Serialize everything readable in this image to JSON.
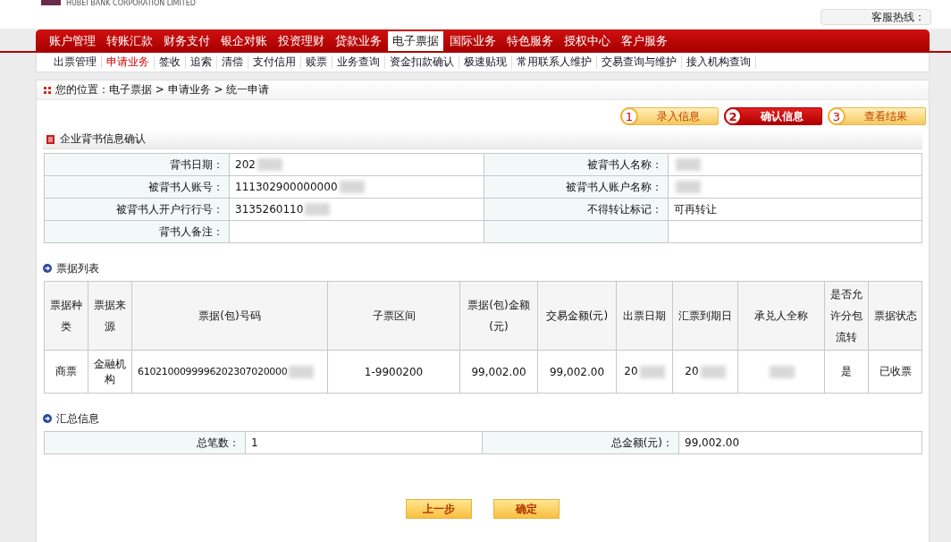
{
  "header": {
    "bank_subtitle": "HUBEI BANK CORPORATION LIMITED",
    "hotline_label": "客服热线："
  },
  "main_nav": [
    {
      "label": "账户管理",
      "selected": false
    },
    {
      "label": "转账汇款",
      "selected": false
    },
    {
      "label": "财务支付",
      "selected": false
    },
    {
      "label": "银企对账",
      "selected": false
    },
    {
      "label": "投资理财",
      "selected": false
    },
    {
      "label": "贷款业务",
      "selected": false
    },
    {
      "label": "电子票据",
      "selected": true
    },
    {
      "label": "国际业务",
      "selected": false
    },
    {
      "label": "特色服务",
      "selected": false
    },
    {
      "label": "授权中心",
      "selected": false
    },
    {
      "label": "客户服务",
      "selected": false
    }
  ],
  "sub_nav": [
    {
      "label": "出票管理",
      "selected": false
    },
    {
      "label": "申请业务",
      "selected": true
    },
    {
      "label": "签收",
      "selected": false
    },
    {
      "label": "追索",
      "selected": false
    },
    {
      "label": "清偿",
      "selected": false
    },
    {
      "label": "支付信用",
      "selected": false
    },
    {
      "label": "赎票",
      "selected": false
    },
    {
      "label": "业务查询",
      "selected": false
    },
    {
      "label": "资金扣款确认",
      "selected": false
    },
    {
      "label": "极速贴现",
      "selected": false
    },
    {
      "label": "常用联系人维护",
      "selected": false
    },
    {
      "label": "交易查询与维护",
      "selected": false
    },
    {
      "label": "接入机构查询",
      "selected": false
    }
  ],
  "breadcrumb": "您的位置：电子票据 > 申请业务 > 统一申请",
  "steps": [
    {
      "number": "1",
      "label": "录入信息",
      "selected": false
    },
    {
      "number": "2",
      "label": "确认信息",
      "selected": true
    },
    {
      "number": "3",
      "label": "查看结果",
      "selected": false
    }
  ],
  "endorsement": {
    "title": "企业背书信息确认",
    "rows": [
      {
        "label_1": "背书日期：",
        "value_1": "202",
        "blurred_1": true,
        "label_2": "被背书人名称：",
        "value_2": "",
        "blurred_2": true
      },
      {
        "label_1": "被背书人账号：",
        "value_1": "111302900000000",
        "blurred_1": true,
        "label_2": "被背书人账户名称：",
        "value_2": "",
        "blurred_2": true
      },
      {
        "label_1": "被背书人开户行行号：",
        "value_1": "3135260110",
        "blurred_1": true,
        "label_2": "不得转让标记：",
        "value_2": "可再转让",
        "blurred_2": false
      },
      {
        "label_1": "背书人备注：",
        "value_1": "",
        "blurred_1": false,
        "label_2": "",
        "value_2": "",
        "blurred_2": false
      }
    ]
  },
  "bills": {
    "title": "票据列表",
    "columns": [
      "票据种类",
      "票据来源",
      "票据(包)号码",
      "子票区间",
      "票据(包)金额(元)",
      "交易金额(元)",
      "出票日期",
      "汇票到期日",
      "承兑人全称",
      "是否允许分包流转",
      "票据状态"
    ],
    "rows": [
      {
        "cells": [
          {
            "text": "商票",
            "blurred": false
          },
          {
            "text": "金融机构",
            "blurred": false
          },
          {
            "text": "6102100099996202307020000",
            "blurred": true
          },
          {
            "text": "1-9900200",
            "blurred": false
          },
          {
            "text": "99,002.00",
            "blurred": false
          },
          {
            "text": "99,002.00",
            "blurred": false
          },
          {
            "text": "20",
            "blurred": true
          },
          {
            "text": "20",
            "blurred": true
          },
          {
            "text": "",
            "blurred": true
          },
          {
            "text": "是",
            "blurred": false
          },
          {
            "text": "已收票",
            "blurred": false
          }
        ]
      }
    ]
  },
  "summary": {
    "title": "汇总信息",
    "count_label": "总笔数：",
    "count": "1",
    "amount_label": "总金额(元)：",
    "amount": "99,002.00"
  },
  "buttons": [
    "上一步",
    "确定"
  ]
}
